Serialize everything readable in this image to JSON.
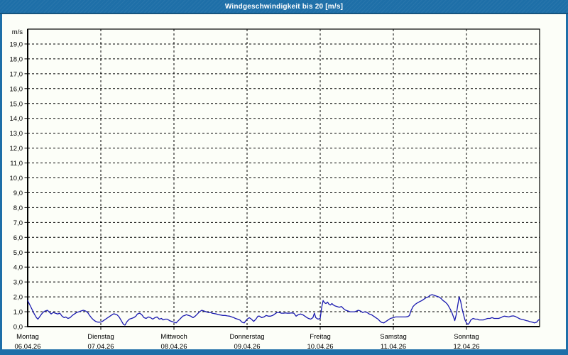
{
  "window": {
    "title": "Windgeschwindigkeit bis 20 [m/s]"
  },
  "colors": {
    "frame": "#1e6fa8",
    "frame_dark": "#15547e",
    "chart_bg": "#fcfef8",
    "title_text": "#ffffff",
    "grid": "#000000",
    "line": "#1a1ab0",
    "label_text": "#000000"
  },
  "chart_data": {
    "type": "line",
    "title": "Windgeschwindigkeit bis 20 [m/s]",
    "y_axis": {
      "unit_label": "m/s",
      "min": 0,
      "max": 20,
      "tick_step": 1,
      "tick_labels_top_to_bottom": [
        "19,0",
        "18,0",
        "17,0",
        "16,0",
        "15,0",
        "14,0",
        "13,0",
        "12,0",
        "11,0",
        "10,0",
        "9,0",
        "8,0",
        "7,0",
        "6,0",
        "5,0",
        "4,0",
        "3,0",
        "2,0",
        "1,0",
        "0,0"
      ],
      "grid": "dashed-horizontal"
    },
    "x_axis": {
      "grid": "dashed-vertical-at-day-starts",
      "days": [
        {
          "name": "Montag",
          "date": "06.04.26"
        },
        {
          "name": "Dienstag",
          "date": "07.04.26"
        },
        {
          "name": "Mittwoch",
          "date": "08.04.26"
        },
        {
          "name": "Donnerstag",
          "date": "09.04.26"
        },
        {
          "name": "Freitag",
          "date": "10.04.26"
        },
        {
          "name": "Samstag",
          "date": "11.04.26"
        },
        {
          "name": "Sonntag",
          "date": "12.04.26"
        }
      ]
    },
    "series": [
      {
        "name": "Windgeschwindigkeit",
        "unit": "m/s",
        "x_unit": "days_from_monday_06_04_26",
        "color": "#1a1ab0",
        "points": [
          [
            0,
            1.75
          ],
          [
            0.03,
            1.45
          ],
          [
            0.06,
            1.15
          ],
          [
            0.09,
            0.85
          ],
          [
            0.12,
            0.6
          ],
          [
            0.14,
            0.5
          ],
          [
            0.17,
            0.7
          ],
          [
            0.19,
            0.85
          ],
          [
            0.22,
            1
          ],
          [
            0.24,
            1.05
          ],
          [
            0.27,
            1.1
          ],
          [
            0.3,
            0.95
          ],
          [
            0.32,
            0.85
          ],
          [
            0.35,
            0.95
          ],
          [
            0.38,
            0.9
          ],
          [
            0.41,
            0.85
          ],
          [
            0.44,
            0.9
          ],
          [
            0.47,
            0.7
          ],
          [
            0.5,
            0.6
          ],
          [
            0.52,
            0.65
          ],
          [
            0.55,
            0.55
          ],
          [
            0.58,
            0.6
          ],
          [
            0.61,
            0.75
          ],
          [
            0.64,
            0.85
          ],
          [
            0.67,
            0.95
          ],
          [
            0.7,
            1
          ],
          [
            0.73,
            1.05
          ],
          [
            0.76,
            1.1
          ],
          [
            0.79,
            1.05
          ],
          [
            0.82,
            0.95
          ],
          [
            0.84,
            0.8
          ],
          [
            0.87,
            0.6
          ],
          [
            0.9,
            0.45
          ],
          [
            0.93,
            0.35
          ],
          [
            0.96,
            0.3
          ],
          [
            0.99,
            0.3
          ],
          [
            1.02,
            0.35
          ],
          [
            1.05,
            0.45
          ],
          [
            1.08,
            0.55
          ],
          [
            1.11,
            0.65
          ],
          [
            1.14,
            0.75
          ],
          [
            1.17,
            0.85
          ],
          [
            1.19,
            0.85
          ],
          [
            1.22,
            0.8
          ],
          [
            1.25,
            0.65
          ],
          [
            1.28,
            0.4
          ],
          [
            1.31,
            0.15
          ],
          [
            1.33,
            0.1
          ],
          [
            1.36,
            0.35
          ],
          [
            1.39,
            0.5
          ],
          [
            1.42,
            0.55
          ],
          [
            1.45,
            0.6
          ],
          [
            1.48,
            0.7
          ],
          [
            1.5,
            0.85
          ],
          [
            1.53,
            0.9
          ],
          [
            1.56,
            0.8
          ],
          [
            1.59,
            0.6
          ],
          [
            1.62,
            0.55
          ],
          [
            1.65,
            0.65
          ],
          [
            1.68,
            0.6
          ],
          [
            1.71,
            0.5
          ],
          [
            1.74,
            0.6
          ],
          [
            1.77,
            0.65
          ],
          [
            1.8,
            0.5
          ],
          [
            1.83,
            0.55
          ],
          [
            1.85,
            0.45
          ],
          [
            1.88,
            0.5
          ],
          [
            1.91,
            0.5
          ],
          [
            1.94,
            0.4
          ],
          [
            1.97,
            0.35
          ],
          [
            2,
            0.3
          ],
          [
            2.03,
            0.25
          ],
          [
            2.06,
            0.4
          ],
          [
            2.09,
            0.55
          ],
          [
            2.12,
            0.7
          ],
          [
            2.15,
            0.75
          ],
          [
            2.17,
            0.8
          ],
          [
            2.2,
            0.75
          ],
          [
            2.23,
            0.7
          ],
          [
            2.26,
            0.6
          ],
          [
            2.29,
            0.7
          ],
          [
            2.32,
            0.85
          ],
          [
            2.35,
            1
          ],
          [
            2.38,
            1.1
          ],
          [
            2.41,
            1.05
          ],
          [
            2.44,
            1
          ],
          [
            2.47,
            0.95
          ],
          [
            2.5,
            0.95
          ],
          [
            2.52,
            0.9
          ],
          [
            2.55,
            0.88
          ],
          [
            2.58,
            0.85
          ],
          [
            2.61,
            0.8
          ],
          [
            2.64,
            0.78
          ],
          [
            2.67,
            0.75
          ],
          [
            2.7,
            0.75
          ],
          [
            2.73,
            0.72
          ],
          [
            2.76,
            0.7
          ],
          [
            2.79,
            0.65
          ],
          [
            2.82,
            0.6
          ],
          [
            2.84,
            0.55
          ],
          [
            2.87,
            0.5
          ],
          [
            2.9,
            0.45
          ],
          [
            2.93,
            0.3
          ],
          [
            2.96,
            0.25
          ],
          [
            3,
            0.5
          ],
          [
            3.03,
            0.6
          ],
          [
            3.06,
            0.5
          ],
          [
            3.09,
            0.35
          ],
          [
            3.12,
            0.5
          ],
          [
            3.15,
            0.7
          ],
          [
            3.17,
            0.7
          ],
          [
            3.2,
            0.6
          ],
          [
            3.23,
            0.65
          ],
          [
            3.26,
            0.75
          ],
          [
            3.29,
            0.7
          ],
          [
            3.32,
            0.7
          ],
          [
            3.35,
            0.75
          ],
          [
            3.38,
            0.85
          ],
          [
            3.41,
            0.95
          ],
          [
            3.44,
            0.95
          ],
          [
            3.47,
            0.9
          ],
          [
            3.5,
            0.9
          ],
          [
            3.52,
            0.92
          ],
          [
            3.55,
            0.9
          ],
          [
            3.58,
            0.9
          ],
          [
            3.61,
            0.92
          ],
          [
            3.64,
            0.9
          ],
          [
            3.67,
            0.7
          ],
          [
            3.7,
            0.8
          ],
          [
            3.73,
            0.85
          ],
          [
            3.76,
            0.8
          ],
          [
            3.79,
            0.7
          ],
          [
            3.82,
            0.6
          ],
          [
            3.84,
            0.55
          ],
          [
            3.87,
            0.5
          ],
          [
            3.9,
            0.6
          ],
          [
            3.92,
            0.9
          ],
          [
            3.94,
            0.6
          ],
          [
            3.97,
            0.5
          ],
          [
            4,
            0.55
          ],
          [
            4.02,
            1.3
          ],
          [
            4.04,
            1.75
          ],
          [
            4.06,
            1.6
          ],
          [
            4.08,
            1.55
          ],
          [
            4.1,
            1.65
          ],
          [
            4.12,
            1.5
          ],
          [
            4.14,
            1.45
          ],
          [
            4.16,
            1.55
          ],
          [
            4.18,
            1.45
          ],
          [
            4.2,
            1.4
          ],
          [
            4.23,
            1.35
          ],
          [
            4.26,
            1.3
          ],
          [
            4.29,
            1.35
          ],
          [
            4.32,
            1.2
          ],
          [
            4.35,
            1.1
          ],
          [
            4.38,
            1.05
          ],
          [
            4.41,
            1
          ],
          [
            4.44,
            1
          ],
          [
            4.47,
            1
          ],
          [
            4.5,
            1.05
          ],
          [
            4.52,
            1.1
          ],
          [
            4.55,
            1.05
          ],
          [
            4.58,
            0.95
          ],
          [
            4.61,
            1
          ],
          [
            4.64,
            0.95
          ],
          [
            4.67,
            0.85
          ],
          [
            4.7,
            0.8
          ],
          [
            4.73,
            0.7
          ],
          [
            4.76,
            0.6
          ],
          [
            4.79,
            0.5
          ],
          [
            4.82,
            0.35
          ],
          [
            4.84,
            0.28
          ],
          [
            4.87,
            0.25
          ],
          [
            4.9,
            0.35
          ],
          [
            4.93,
            0.45
          ],
          [
            4.96,
            0.55
          ],
          [
            5,
            0.6
          ],
          [
            5.03,
            0.65
          ],
          [
            5.06,
            0.65
          ],
          [
            5.09,
            0.65
          ],
          [
            5.12,
            0.65
          ],
          [
            5.15,
            0.65
          ],
          [
            5.17,
            0.65
          ],
          [
            5.2,
            0.68
          ],
          [
            5.22,
            0.75
          ],
          [
            5.24,
            1.05
          ],
          [
            5.27,
            1.35
          ],
          [
            5.3,
            1.5
          ],
          [
            5.33,
            1.6
          ],
          [
            5.36,
            1.68
          ],
          [
            5.39,
            1.75
          ],
          [
            5.42,
            1.85
          ],
          [
            5.45,
            1.95
          ],
          [
            5.48,
            2
          ],
          [
            5.5,
            2.1
          ],
          [
            5.53,
            2.15
          ],
          [
            5.56,
            2.1
          ],
          [
            5.59,
            2.05
          ],
          [
            5.62,
            2
          ],
          [
            5.65,
            1.9
          ],
          [
            5.68,
            1.75
          ],
          [
            5.71,
            1.65
          ],
          [
            5.74,
            1.5
          ],
          [
            5.77,
            1.25
          ],
          [
            5.8,
            0.95
          ],
          [
            5.83,
            0.55
          ],
          [
            5.84,
            0.4
          ],
          [
            5.86,
            0.8
          ],
          [
            5.88,
            1.4
          ],
          [
            5.9,
            2
          ],
          [
            5.92,
            1.7
          ],
          [
            5.94,
            1.2
          ],
          [
            5.96,
            0.8
          ],
          [
            5.98,
            0.45
          ],
          [
            6,
            0.25
          ],
          [
            6.02,
            0.15
          ],
          [
            6.04,
            0.25
          ],
          [
            6.06,
            0.45
          ],
          [
            6.09,
            0.55
          ],
          [
            6.12,
            0.5
          ],
          [
            6.15,
            0.5
          ],
          [
            6.17,
            0.45
          ],
          [
            6.2,
            0.45
          ],
          [
            6.23,
            0.45
          ],
          [
            6.26,
            0.5
          ],
          [
            6.29,
            0.55
          ],
          [
            6.32,
            0.55
          ],
          [
            6.35,
            0.6
          ],
          [
            6.38,
            0.55
          ],
          [
            6.41,
            0.55
          ],
          [
            6.44,
            0.55
          ],
          [
            6.47,
            0.6
          ],
          [
            6.5,
            0.68
          ],
          [
            6.52,
            0.7
          ],
          [
            6.55,
            0.68
          ],
          [
            6.58,
            0.65
          ],
          [
            6.61,
            0.7
          ],
          [
            6.64,
            0.72
          ],
          [
            6.67,
            0.68
          ],
          [
            6.7,
            0.6
          ],
          [
            6.73,
            0.52
          ],
          [
            6.76,
            0.48
          ],
          [
            6.79,
            0.45
          ],
          [
            6.82,
            0.4
          ],
          [
            6.84,
            0.38
          ],
          [
            6.87,
            0.33
          ],
          [
            6.9,
            0.3
          ],
          [
            6.93,
            0.25
          ],
          [
            6.96,
            0.3
          ],
          [
            6.98,
            0.42
          ],
          [
            7,
            0.5
          ]
        ]
      }
    ]
  }
}
